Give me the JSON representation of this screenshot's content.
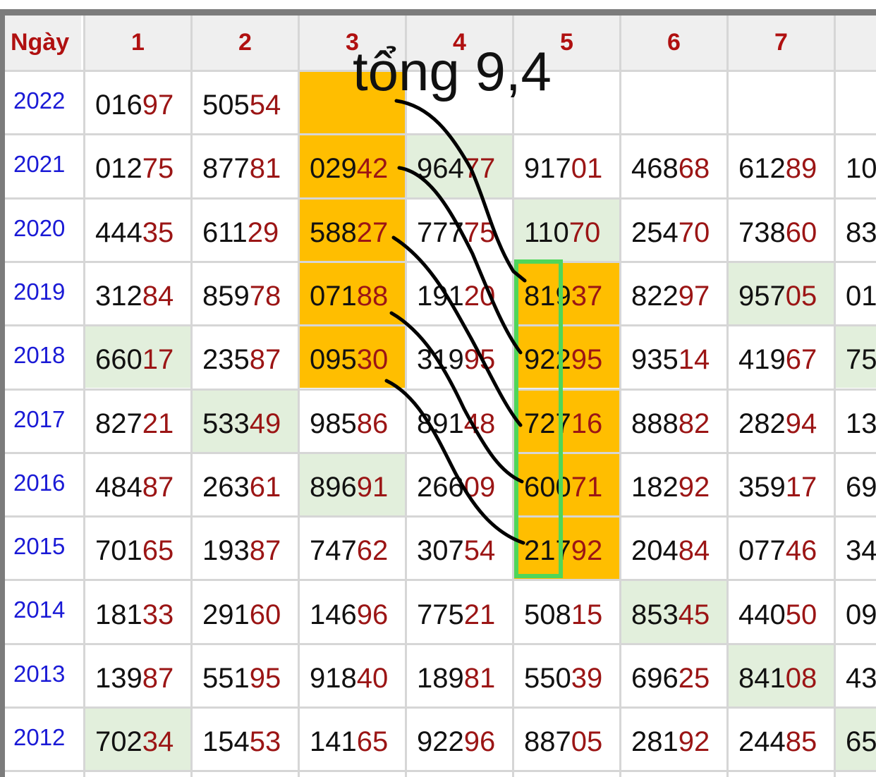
{
  "table": {
    "headers": [
      "Ngày",
      "1",
      "2",
      "3",
      "4",
      "5",
      "6",
      "7",
      ""
    ],
    "rows": [
      {
        "year": "2022",
        "cells": [
          {
            "head": "016",
            "tail": "97",
            "bg": "white"
          },
          {
            "head": "505",
            "tail": "54",
            "bg": "white"
          },
          {
            "head": "",
            "tail": "",
            "bg": "highlight"
          },
          {
            "head": "",
            "tail": "",
            "bg": "white"
          },
          {
            "head": "",
            "tail": "",
            "bg": "white"
          },
          {
            "head": "",
            "tail": "",
            "bg": "white"
          },
          {
            "head": "",
            "tail": "",
            "bg": "white"
          },
          {
            "head": "",
            "tail": "",
            "bg": "white"
          }
        ]
      },
      {
        "year": "2021",
        "cells": [
          {
            "head": "012",
            "tail": "75",
            "bg": "white"
          },
          {
            "head": "877",
            "tail": "81",
            "bg": "white"
          },
          {
            "head": "029",
            "tail": "42",
            "bg": "highlight"
          },
          {
            "head": "964",
            "tail": "77",
            "bg": "green"
          },
          {
            "head": "917",
            "tail": "01",
            "bg": "white"
          },
          {
            "head": "468",
            "tail": "68",
            "bg": "white"
          },
          {
            "head": "612",
            "tail": "89",
            "bg": "white"
          },
          {
            "head": "10",
            "tail": "",
            "bg": "white"
          }
        ]
      },
      {
        "year": "2020",
        "cells": [
          {
            "head": "444",
            "tail": "35",
            "bg": "white"
          },
          {
            "head": "611",
            "tail": "29",
            "bg": "white"
          },
          {
            "head": "588",
            "tail": "27",
            "bg": "highlight"
          },
          {
            "head": "777",
            "tail": "75",
            "bg": "white"
          },
          {
            "head": "110",
            "tail": "70",
            "bg": "green"
          },
          {
            "head": "254",
            "tail": "70",
            "bg": "white"
          },
          {
            "head": "738",
            "tail": "60",
            "bg": "white"
          },
          {
            "head": "83",
            "tail": "",
            "bg": "white"
          }
        ]
      },
      {
        "year": "2019",
        "cells": [
          {
            "head": "312",
            "tail": "84",
            "bg": "white"
          },
          {
            "head": "859",
            "tail": "78",
            "bg": "white"
          },
          {
            "head": "071",
            "tail": "88",
            "bg": "highlight"
          },
          {
            "head": "191",
            "tail": "20",
            "bg": "white"
          },
          {
            "head": "819",
            "tail": "37",
            "bg": "highlight"
          },
          {
            "head": "822",
            "tail": "97",
            "bg": "white"
          },
          {
            "head": "957",
            "tail": "05",
            "bg": "green"
          },
          {
            "head": "01",
            "tail": "",
            "bg": "white"
          }
        ]
      },
      {
        "year": "2018",
        "cells": [
          {
            "head": "660",
            "tail": "17",
            "bg": "green"
          },
          {
            "head": "235",
            "tail": "87",
            "bg": "white"
          },
          {
            "head": "095",
            "tail": "30",
            "bg": "highlight"
          },
          {
            "head": "319",
            "tail": "95",
            "bg": "white"
          },
          {
            "head": "922",
            "tail": "95",
            "bg": "highlight"
          },
          {
            "head": "935",
            "tail": "14",
            "bg": "white"
          },
          {
            "head": "419",
            "tail": "67",
            "bg": "white"
          },
          {
            "head": "75",
            "tail": "",
            "bg": "green"
          }
        ]
      },
      {
        "year": "2017",
        "cells": [
          {
            "head": "827",
            "tail": "21",
            "bg": "white"
          },
          {
            "head": "533",
            "tail": "49",
            "bg": "green"
          },
          {
            "head": "985",
            "tail": "86",
            "bg": "white"
          },
          {
            "head": "891",
            "tail": "48",
            "bg": "white"
          },
          {
            "head": "727",
            "tail": "16",
            "bg": "highlight"
          },
          {
            "head": "888",
            "tail": "82",
            "bg": "white"
          },
          {
            "head": "282",
            "tail": "94",
            "bg": "white"
          },
          {
            "head": "13",
            "tail": "",
            "bg": "white"
          }
        ]
      },
      {
        "year": "2016",
        "cells": [
          {
            "head": "484",
            "tail": "87",
            "bg": "white"
          },
          {
            "head": "263",
            "tail": "61",
            "bg": "white"
          },
          {
            "head": "896",
            "tail": "91",
            "bg": "green"
          },
          {
            "head": "266",
            "tail": "09",
            "bg": "white"
          },
          {
            "head": "600",
            "tail": "71",
            "bg": "highlight"
          },
          {
            "head": "182",
            "tail": "92",
            "bg": "white"
          },
          {
            "head": "359",
            "tail": "17",
            "bg": "white"
          },
          {
            "head": "69",
            "tail": "",
            "bg": "white"
          }
        ]
      },
      {
        "year": "2015",
        "cells": [
          {
            "head": "701",
            "tail": "65",
            "bg": "white"
          },
          {
            "head": "193",
            "tail": "87",
            "bg": "white"
          },
          {
            "head": "747",
            "tail": "62",
            "bg": "white"
          },
          {
            "head": "307",
            "tail": "54",
            "bg": "white"
          },
          {
            "head": "217",
            "tail": "92",
            "bg": "highlight"
          },
          {
            "head": "204",
            "tail": "84",
            "bg": "white"
          },
          {
            "head": "077",
            "tail": "46",
            "bg": "white"
          },
          {
            "head": "34",
            "tail": "",
            "bg": "white"
          }
        ]
      },
      {
        "year": "2014",
        "cells": [
          {
            "head": "181",
            "tail": "33",
            "bg": "white"
          },
          {
            "head": "291",
            "tail": "60",
            "bg": "white"
          },
          {
            "head": "146",
            "tail": "96",
            "bg": "white"
          },
          {
            "head": "775",
            "tail": "21",
            "bg": "white"
          },
          {
            "head": "508",
            "tail": "15",
            "bg": "white"
          },
          {
            "head": "853",
            "tail": "45",
            "bg": "green"
          },
          {
            "head": "440",
            "tail": "50",
            "bg": "white"
          },
          {
            "head": "09",
            "tail": "",
            "bg": "white"
          }
        ]
      },
      {
        "year": "2013",
        "cells": [
          {
            "head": "139",
            "tail": "87",
            "bg": "white"
          },
          {
            "head": "551",
            "tail": "95",
            "bg": "white"
          },
          {
            "head": "918",
            "tail": "40",
            "bg": "white"
          },
          {
            "head": "189",
            "tail": "81",
            "bg": "white"
          },
          {
            "head": "550",
            "tail": "39",
            "bg": "white"
          },
          {
            "head": "696",
            "tail": "25",
            "bg": "white"
          },
          {
            "head": "841",
            "tail": "08",
            "bg": "green"
          },
          {
            "head": "43",
            "tail": "",
            "bg": "white"
          }
        ]
      },
      {
        "year": "2012",
        "cells": [
          {
            "head": "702",
            "tail": "34",
            "bg": "green"
          },
          {
            "head": "154",
            "tail": "53",
            "bg": "white"
          },
          {
            "head": "141",
            "tail": "65",
            "bg": "white"
          },
          {
            "head": "922",
            "tail": "96",
            "bg": "white"
          },
          {
            "head": "887",
            "tail": "05",
            "bg": "white"
          },
          {
            "head": "281",
            "tail": "92",
            "bg": "white"
          },
          {
            "head": "244",
            "tail": "85",
            "bg": "white"
          },
          {
            "head": "65",
            "tail": "",
            "bg": "green"
          }
        ]
      }
    ]
  },
  "annotation": {
    "text": "tổng 9,4",
    "ink_color": "#000000",
    "box_color": "#4fd65a"
  },
  "colors": {
    "highlight": "#ffbe00",
    "green": "#e2efdc",
    "header_bg": "#efefef",
    "header_text": "#b01010",
    "year_text": "#1a1ad6",
    "number_tail": "#9b1515",
    "grid_line": "#9a9a9a"
  }
}
